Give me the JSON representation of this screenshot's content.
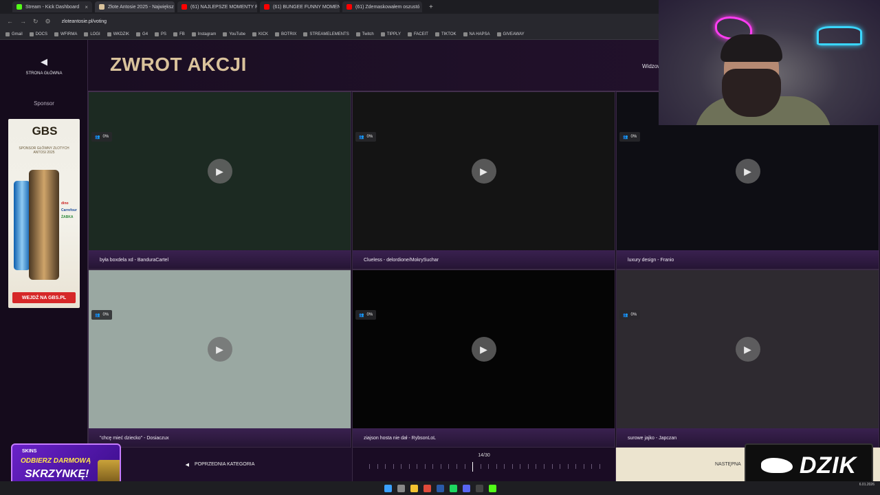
{
  "browser": {
    "tabs": [
      {
        "label": "Stream - Kick Dashboard",
        "color": "#53fc18",
        "active": false
      },
      {
        "label": "Złote Antosie 2025 - Największ",
        "color": "#d9c29b",
        "active": true
      },
      {
        "label": "(61) NAJLEPSZE MOMENTY PO",
        "color": "#ff0000",
        "active": false
      },
      {
        "label": "(61) BUNGEE FUNNY MOMENT",
        "color": "#ff0000",
        "active": false
      },
      {
        "label": "(61) Zdemaskowałem oszustó",
        "color": "#ff0000",
        "active": false
      }
    ],
    "url": "zloteantosie.pl/voting",
    "bookmarks": [
      "Gmail",
      "DOCS",
      "WFIRMA",
      "LOGI",
      "WKDZIK",
      "G4",
      "PS",
      "FB",
      "Instagram",
      "YouTube",
      "KICK",
      "BOTRIX",
      "STREAMELEMENTS",
      "Twitch",
      "TIPPLY",
      "FACEIT",
      "TIKTOK",
      "NA HAPSA",
      "GIVEAWAY"
    ]
  },
  "sidebar": {
    "home_label": "STRONA GŁÓWNA",
    "sponsor_label": "Sponsor",
    "ad": {
      "logo": "GBS",
      "sub": "SPONSOR GŁÓWNY ZŁOTYCH ANTOSI 2025",
      "stores": [
        "dino",
        "Carrefour",
        "ŻABKA"
      ],
      "cta": "WEJDŹ NA GBS.PL"
    }
  },
  "header": {
    "title": "ZWROT AKCJI",
    "viewers_label": "Widzow"
  },
  "videos": [
    {
      "caption": "była boxdela xd - BanduraCartel",
      "views": "0%",
      "bg": "#1c2a22"
    },
    {
      "caption": "Clueless - delordione/MokrySuchar",
      "views": "0%",
      "bg": "#141414"
    },
    {
      "caption": "luxury design - Franio",
      "views": "0%",
      "bg": "#0e0e14"
    },
    {
      "caption": "\"chcę mieć dziecko\" - Dosiaczux",
      "views": "0%",
      "bg": "#9aa8a2"
    },
    {
      "caption": "ziajson hosta nie dał - RybsonLoL",
      "views": "0%",
      "bg": "#050505"
    },
    {
      "caption": "surowe jajko - Japczan",
      "views": "0%",
      "bg": "#2e2a30"
    }
  ],
  "footer": {
    "prev_label": "POPRZEDNIA KATEGORIA",
    "counter": "14/30",
    "current": 14,
    "total": 30,
    "next_label": "NASTĘPNA"
  },
  "overlays": {
    "skins_brand": "SKINS",
    "skins_line1": "ODBIERZ DARMOWĄ",
    "skins_line2": "SKRZYNKĘ!",
    "dzik": "DZIK"
  },
  "taskbar": {
    "date": "6.01.2026",
    "icons": [
      "windows-icon",
      "search-icon",
      "files-icon",
      "chrome-icon",
      "steam-icon",
      "spotify-icon",
      "discord-icon",
      "obs-icon",
      "kick-icon"
    ]
  }
}
